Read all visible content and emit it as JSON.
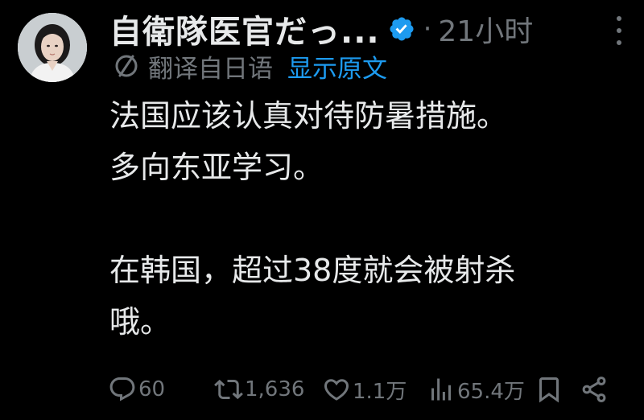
{
  "post": {
    "author": {
      "display_name": "自衛隊医官だっ...",
      "verified": true,
      "avatar_icon": "profile-photo"
    },
    "separator": "·",
    "time": "21小时",
    "translation": {
      "label": "翻译自日语",
      "show_original": "显示原文",
      "icon": "translate-icon"
    },
    "text_lines": [
      "法国应该认真对待防暑措施。",
      "多向东亚学习。",
      "",
      "在韩国，超过38度就会被射杀",
      "哦。"
    ],
    "actions": {
      "replies": "60",
      "reposts": "1,636",
      "likes": "1.1万",
      "views": "65.4万"
    }
  },
  "colors": {
    "background": "#000000",
    "text": "#e7e9ea",
    "muted": "#71767b",
    "link": "#1d9bf0",
    "verified_badge": "#1d9bf0"
  }
}
